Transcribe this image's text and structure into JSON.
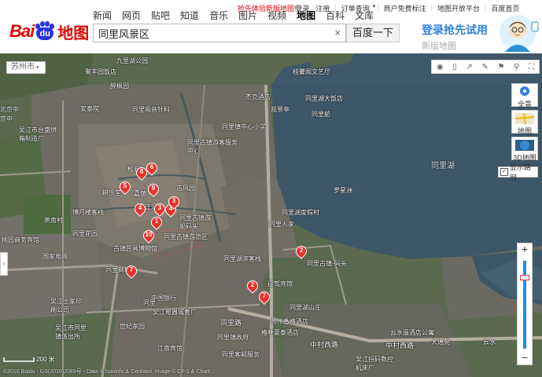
{
  "logo": {
    "text_left": "Bai",
    "text_paw": "du",
    "text_right": "地图"
  },
  "nav": {
    "items": [
      "新闻",
      "网页",
      "贴吧",
      "知道",
      "音乐",
      "图片",
      "视频",
      "地图",
      "百科",
      "文库"
    ],
    "active": "地图"
  },
  "top": {
    "promo_link": "抢先体验新版地图!",
    "links": [
      "登录",
      "注册",
      "订单查询",
      "商户免费标注",
      "地图开放平台",
      "百度首页"
    ]
  },
  "search": {
    "value": "同里风景区",
    "clear": "×",
    "button": "百度一下"
  },
  "promo": {
    "line1": "登录抢先试用",
    "line2": "新版地图"
  },
  "map": {
    "city": "苏州市",
    "side_buttons": [
      "全景",
      "地图",
      "3D地图"
    ],
    "roadnet_label": "显示路网",
    "scale": "200 米",
    "copyright": "©2016 Baidu - GS(2016)2089号 - Data © Navinfo & CenNavi, Image © CF-1 & Chart...",
    "labels": [
      {
        "t": "九里湖公园"
      },
      {
        "t": "聚丰园饭店"
      },
      {
        "t": "醉枫园"
      },
      {
        "t": "安泰院"
      },
      {
        "t": "同里吸音针料"
      },
      {
        "t": "桂馨阁文艺厅"
      },
      {
        "t": "杰克酒店"
      },
      {
        "t": "同里湖大饭店"
      },
      {
        "t": "观景亭"
      },
      {
        "t": "同里舫"
      },
      {
        "t": "同里镇中心小学"
      },
      {
        "t": "吴江市台盛烘箱制造厂"
      },
      {
        "t": "同里古镇游客服务中心"
      },
      {
        "t": "同里湖"
      },
      {
        "t": "罗星洲"
      },
      {
        "t": "松石"
      },
      {
        "t": "耕乐堂"
      },
      {
        "t": "嘉荫"
      },
      {
        "t": "古风园"
      },
      {
        "t": "博月楼客栈"
      },
      {
        "t": "正汇"
      },
      {
        "t": "同里古镇游船码头"
      },
      {
        "t": "同里湖度假村"
      },
      {
        "t": "同里人家"
      },
      {
        "t": "同里花园"
      },
      {
        "t": "同里古镇游览区"
      },
      {
        "t": "桃园商务宾馆"
      },
      {
        "t": "古镇民具博物馆"
      },
      {
        "t": "国家电网"
      },
      {
        "t": "同里湖滨客栈"
      },
      {
        "t": "同里古镇·码头"
      },
      {
        "t": "同里商城"
      },
      {
        "t": "迎驾宾馆"
      },
      {
        "t": "中国银行"
      },
      {
        "t": "吴江士家印刷公司"
      },
      {
        "t": "吴江电器城套厂"
      },
      {
        "t": "世纪家园"
      },
      {
        "t": "同里湖山庄"
      },
      {
        "t": "苏州香格酒店"
      },
      {
        "t": "格林豪泰酒店"
      },
      {
        "t": "同里镇政府"
      },
      {
        "t": "云水遥酒店公寓"
      },
      {
        "t": "大通苑"
      },
      {
        "t": "云水"
      },
      {
        "t": "中村西路"
      },
      {
        "t": "中村西路"
      },
      {
        "t": "江南宾馆"
      },
      {
        "t": "同里客邮服务"
      },
      {
        "t": "吴江市同里镇派出所"
      },
      {
        "t": "吴江拐码数控机床厂"
      },
      {
        "t": "燕南村"
      },
      {
        "t": "同里路"
      },
      {
        "t": "北京中"
      },
      {
        "t": "京中"
      },
      {
        "t": "同里"
      }
    ],
    "pins": [
      "1",
      "2",
      "3",
      "4",
      "5",
      "6",
      "7",
      "8",
      "9",
      "10",
      "2",
      "7",
      "4",
      "3"
    ]
  }
}
